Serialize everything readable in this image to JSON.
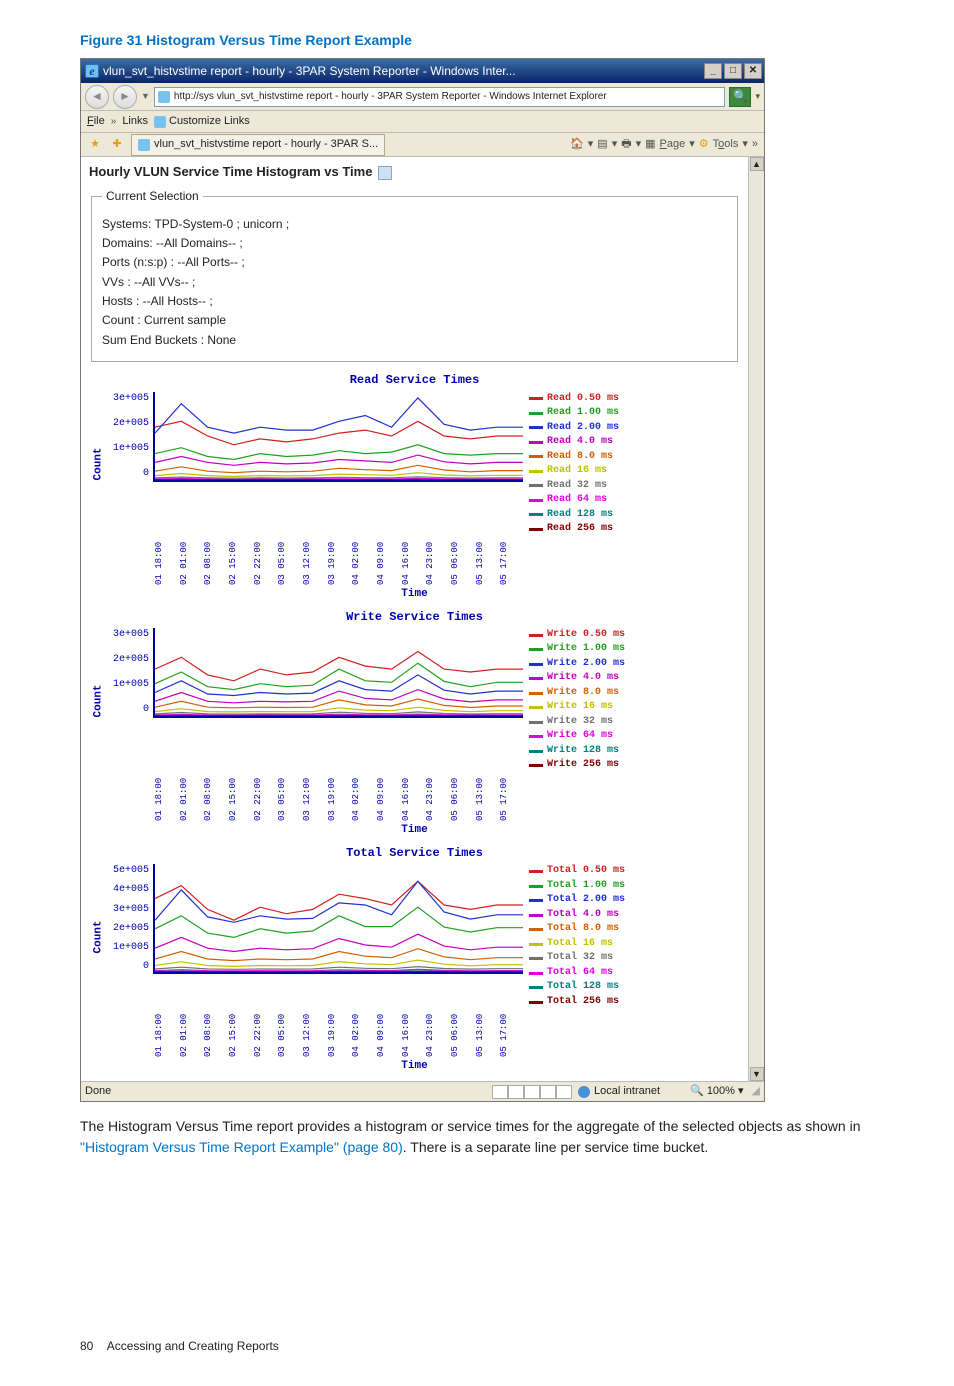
{
  "figure_caption": "Figure 31 Histogram Versus Time Report Example",
  "window": {
    "title": "vlun_svt_histvstime report - hourly - 3PAR System Reporter - Windows Inter...",
    "min": "_",
    "max": "□",
    "close": "✕"
  },
  "address": {
    "url": "http://sys vlun_svt_histvstime report - hourly - 3PAR System Reporter - Windows Internet Explorer",
    "go": "→"
  },
  "linksrow": {
    "file": "File",
    "chev": "»",
    "links": "Links",
    "customize": "Customize Links"
  },
  "tabsrow": {
    "tab_title": "vlun_svt_histvstime report - hourly - 3PAR S...",
    "page": "Page",
    "tools": "Tools",
    "chev": "»"
  },
  "report": {
    "title": "Hourly VLUN Service Time Histogram vs Time"
  },
  "selection": {
    "legend": "Current Selection",
    "systems": "Systems: TPD-System-0 ; unicorn ;",
    "domains": "Domains: --All Domains-- ;",
    "ports": "Ports (n:s:p) : --All Ports-- ;",
    "vvs": "VVs : --All VVs-- ;",
    "hosts": "Hosts : --All Hosts-- ;",
    "count": "Count : Current sample",
    "sum_end": "Sum End Buckets : None"
  },
  "charts": {
    "x_ticks": [
      "01 18:00",
      "02 01:00",
      "02 08:00",
      "02 15:00",
      "02 22:00",
      "03 05:00",
      "03 12:00",
      "03 19:00",
      "04 02:00",
      "04 09:00",
      "04 16:00",
      "04 23:00",
      "05 06:00",
      "05 13:00",
      "05 17:00"
    ],
    "x_title": "Time",
    "read": {
      "title": "Read Service Times",
      "ylabel": "Count",
      "yticks": [
        "3e+005",
        "2e+005",
        "1e+005",
        "0"
      ],
      "legend": [
        {
          "label": "Read 0.50 ms",
          "color": "#d02020"
        },
        {
          "label": "Read 1.00 ms",
          "color": "#20a020"
        },
        {
          "label": "Read 2.00 ms",
          "color": "#2030d0"
        },
        {
          "label": "Read 4.0 ms",
          "color": "#c000c0"
        },
        {
          "label": "Read 8.0 ms",
          "color": "#d06000"
        },
        {
          "label": "Read 16 ms",
          "color": "#c0c000"
        },
        {
          "label": "Read 32 ms",
          "color": "#707070"
        },
        {
          "label": "Read 64 ms",
          "color": "#e000e0"
        },
        {
          "label": "Read 128 ms",
          "color": "#008080"
        },
        {
          "label": "Read 256 ms",
          "color": "#800000"
        }
      ]
    },
    "write": {
      "title": "Write Service Times",
      "ylabel": "Count",
      "yticks": [
        "3e+005",
        "2e+005",
        "1e+005",
        "0"
      ],
      "legend": [
        {
          "label": "Write 0.50 ms",
          "color": "#d02020"
        },
        {
          "label": "Write 1.00 ms",
          "color": "#20a020"
        },
        {
          "label": "Write 2.00 ms",
          "color": "#2030d0"
        },
        {
          "label": "Write 4.0 ms",
          "color": "#c000c0"
        },
        {
          "label": "Write 8.0 ms",
          "color": "#d06000"
        },
        {
          "label": "Write 16 ms",
          "color": "#c0c000"
        },
        {
          "label": "Write 32 ms",
          "color": "#707070"
        },
        {
          "label": "Write 64 ms",
          "color": "#e000e0"
        },
        {
          "label": "Write 128 ms",
          "color": "#008080"
        },
        {
          "label": "Write 256 ms",
          "color": "#800000"
        }
      ]
    },
    "total": {
      "title": "Total Service Times",
      "ylabel": "Count",
      "yticks": [
        "5e+005",
        "4e+005",
        "3e+005",
        "2e+005",
        "1e+005",
        "0"
      ],
      "legend": [
        {
          "label": "Total 0.50 ms",
          "color": "#d02020"
        },
        {
          "label": "Total 1.00 ms",
          "color": "#20a020"
        },
        {
          "label": "Total 2.00 ms",
          "color": "#2030d0"
        },
        {
          "label": "Total 4.0 ms",
          "color": "#c000c0"
        },
        {
          "label": "Total 8.0 ms",
          "color": "#d06000"
        },
        {
          "label": "Total 16 ms",
          "color": "#c0c000"
        },
        {
          "label": "Total 32 ms",
          "color": "#707070"
        },
        {
          "label": "Total 64 ms",
          "color": "#e000e0"
        },
        {
          "label": "Total 128 ms",
          "color": "#008080"
        },
        {
          "label": "Total 256 ms",
          "color": "#800000"
        }
      ]
    }
  },
  "chart_data": [
    {
      "type": "line",
      "title": "Read Service Times",
      "xlabel": "Time",
      "ylabel": "Count",
      "ylim": [
        0,
        300000
      ],
      "categories": [
        "01 18:00",
        "02 01:00",
        "02 08:00",
        "02 15:00",
        "02 22:00",
        "03 05:00",
        "03 12:00",
        "03 19:00",
        "04 02:00",
        "04 09:00",
        "04 16:00",
        "04 23:00",
        "05 06:00",
        "05 13:00",
        "05 17:00"
      ],
      "series": [
        {
          "name": "Read 0.50 ms",
          "values": [
            180000,
            200000,
            150000,
            120000,
            140000,
            130000,
            140000,
            160000,
            170000,
            150000,
            200000,
            150000,
            140000,
            150000,
            150000
          ]
        },
        {
          "name": "Read 1.00 ms",
          "values": [
            90000,
            110000,
            80000,
            70000,
            90000,
            80000,
            85000,
            100000,
            90000,
            95000,
            120000,
            90000,
            85000,
            90000,
            90000
          ]
        },
        {
          "name": "Read 2.00 ms",
          "values": [
            160000,
            260000,
            180000,
            160000,
            180000,
            170000,
            170000,
            200000,
            220000,
            180000,
            280000,
            190000,
            170000,
            180000,
            180000
          ]
        },
        {
          "name": "Read 4.0 ms",
          "values": [
            60000,
            80000,
            60000,
            50000,
            60000,
            55000,
            58000,
            70000,
            65000,
            60000,
            85000,
            62000,
            55000,
            60000,
            60000
          ]
        },
        {
          "name": "Read 8.0 ms",
          "values": [
            30000,
            45000,
            30000,
            25000,
            30000,
            28000,
            30000,
            40000,
            35000,
            32000,
            50000,
            34000,
            28000,
            32000,
            32000
          ]
        },
        {
          "name": "Read 16 ms",
          "values": [
            15000,
            22000,
            15000,
            12000,
            15000,
            14000,
            15000,
            20000,
            18000,
            16000,
            25000,
            17000,
            14000,
            16000,
            16000
          ]
        },
        {
          "name": "Read 32 ms",
          "values": [
            7000,
            10000,
            7000,
            6000,
            7000,
            6500,
            7000,
            9000,
            8000,
            7500,
            11000,
            7800,
            6500,
            7500,
            7500
          ]
        },
        {
          "name": "Read 64 ms",
          "values": [
            3000,
            5000,
            3000,
            2500,
            3000,
            2800,
            3000,
            4000,
            3500,
            3200,
            5500,
            3400,
            2800,
            3200,
            3200
          ]
        },
        {
          "name": "Read 128 ms",
          "values": [
            1000,
            2000,
            1000,
            900,
            1000,
            950,
            1000,
            1500,
            1200,
            1100,
            2200,
            1150,
            950,
            1100,
            1100
          ]
        },
        {
          "name": "Read 256 ms",
          "values": [
            200,
            500,
            200,
            180,
            200,
            190,
            200,
            300,
            250,
            220,
            550,
            230,
            190,
            220,
            220
          ]
        }
      ]
    },
    {
      "type": "line",
      "title": "Write Service Times",
      "xlabel": "Time",
      "ylabel": "Count",
      "ylim": [
        0,
        300000
      ],
      "categories": [
        "01 18:00",
        "02 01:00",
        "02 08:00",
        "02 15:00",
        "02 22:00",
        "03 05:00",
        "03 12:00",
        "03 19:00",
        "04 02:00",
        "04 09:00",
        "04 16:00",
        "04 23:00",
        "05 06:00",
        "05 13:00",
        "05 17:00"
      ],
      "series": [
        {
          "name": "Write 0.50 ms",
          "values": [
            160000,
            200000,
            140000,
            120000,
            160000,
            140000,
            150000,
            200000,
            170000,
            160000,
            220000,
            160000,
            150000,
            160000,
            160000
          ]
        },
        {
          "name": "Write 1.00 ms",
          "values": [
            110000,
            150000,
            100000,
            90000,
            110000,
            100000,
            105000,
            160000,
            120000,
            115000,
            180000,
            118000,
            100000,
            115000,
            115000
          ]
        },
        {
          "name": "Write 2.00 ms",
          "values": [
            80000,
            120000,
            75000,
            70000,
            80000,
            75000,
            78000,
            120000,
            90000,
            85000,
            140000,
            88000,
            75000,
            85000,
            85000
          ]
        },
        {
          "name": "Write 4.0 ms",
          "values": [
            50000,
            80000,
            50000,
            45000,
            50000,
            48000,
            50000,
            85000,
            60000,
            55000,
            90000,
            58000,
            48000,
            55000,
            55000
          ]
        },
        {
          "name": "Write 8.0 ms",
          "values": [
            30000,
            50000,
            30000,
            28000,
            30000,
            29000,
            30000,
            55000,
            38000,
            34000,
            58000,
            36000,
            29000,
            34000,
            34000
          ]
        },
        {
          "name": "Write 16 ms",
          "values": [
            15000,
            25000,
            15000,
            14000,
            15000,
            14500,
            15000,
            28000,
            20000,
            18000,
            30000,
            19000,
            14500,
            18000,
            18000
          ]
        },
        {
          "name": "Write 32 ms",
          "values": [
            7000,
            12000,
            7000,
            6500,
            7000,
            6800,
            7000,
            13000,
            9000,
            8000,
            14000,
            8500,
            6800,
            8000,
            8000
          ]
        },
        {
          "name": "Write 64 ms",
          "values": [
            3000,
            5500,
            3000,
            2800,
            3000,
            2900,
            3000,
            6000,
            4000,
            3500,
            6500,
            3800,
            2900,
            3500,
            3500
          ]
        },
        {
          "name": "Write 128 ms",
          "values": [
            1000,
            2200,
            1000,
            950,
            1000,
            970,
            1000,
            2400,
            1500,
            1300,
            2600,
            1400,
            970,
            1300,
            1300
          ]
        },
        {
          "name": "Write 256 ms",
          "values": [
            200,
            550,
            200,
            190,
            200,
            195,
            200,
            600,
            300,
            260,
            650,
            280,
            195,
            260,
            260
          ]
        }
      ]
    },
    {
      "type": "line",
      "title": "Total Service Times",
      "xlabel": "Time",
      "ylabel": "Count",
      "ylim": [
        0,
        500000
      ],
      "categories": [
        "01 18:00",
        "02 01:00",
        "02 08:00",
        "02 15:00",
        "02 22:00",
        "03 05:00",
        "03 12:00",
        "03 19:00",
        "04 02:00",
        "04 09:00",
        "04 16:00",
        "04 23:00",
        "05 06:00",
        "05 13:00",
        "05 17:00"
      ],
      "series": [
        {
          "name": "Total 0.50 ms",
          "values": [
            340000,
            400000,
            290000,
            240000,
            300000,
            270000,
            290000,
            360000,
            340000,
            310000,
            420000,
            310000,
            290000,
            310000,
            310000
          ]
        },
        {
          "name": "Total 1.00 ms",
          "values": [
            200000,
            260000,
            180000,
            160000,
            200000,
            180000,
            190000,
            260000,
            210000,
            210000,
            300000,
            208000,
            185000,
            205000,
            205000
          ]
        },
        {
          "name": "Total 2.00 ms",
          "values": [
            240000,
            380000,
            255000,
            230000,
            260000,
            245000,
            248000,
            320000,
            310000,
            265000,
            420000,
            278000,
            245000,
            265000,
            265000
          ]
        },
        {
          "name": "Total 4.0 ms",
          "values": [
            110000,
            160000,
            110000,
            95000,
            110000,
            103000,
            108000,
            155000,
            125000,
            115000,
            175000,
            120000,
            103000,
            115000,
            115000
          ]
        },
        {
          "name": "Total 8.0 ms",
          "values": [
            60000,
            95000,
            60000,
            53000,
            60000,
            57000,
            60000,
            95000,
            73000,
            66000,
            108000,
            70000,
            57000,
            66000,
            66000
          ]
        },
        {
          "name": "Total 16 ms",
          "values": [
            30000,
            47000,
            30000,
            26000,
            30000,
            28500,
            30000,
            48000,
            38000,
            34000,
            55000,
            36000,
            28500,
            34000,
            34000
          ]
        },
        {
          "name": "Total 32 ms",
          "values": [
            14000,
            22000,
            14000,
            12500,
            14000,
            13300,
            14000,
            22000,
            17000,
            15500,
            25000,
            16300,
            13300,
            15500,
            15500
          ]
        },
        {
          "name": "Total 64 ms",
          "values": [
            6000,
            10500,
            6000,
            5300,
            6000,
            5700,
            6000,
            10000,
            7500,
            6700,
            12000,
            7200,
            5700,
            6700,
            6700
          ]
        },
        {
          "name": "Total 128 ms",
          "values": [
            2000,
            4200,
            2000,
            1850,
            2000,
            1920,
            2000,
            3900,
            2700,
            2400,
            4800,
            2550,
            1920,
            2400,
            2400
          ]
        },
        {
          "name": "Total 256 ms",
          "values": [
            400,
            1050,
            400,
            370,
            400,
            385,
            400,
            900,
            550,
            480,
            1200,
            510,
            385,
            480,
            480
          ]
        }
      ]
    }
  ],
  "statusbar": {
    "done": "Done",
    "intranet": "Local intranet",
    "zoom": "100%"
  },
  "body_text": {
    "p1a": "The Histogram Versus Time report provides a histogram or service times for the aggregate of the selected objects as shown in ",
    "link": "\"Histogram Versus Time Report Example\" (page 80)",
    "p1b": ". There is a separate line per service time bucket."
  },
  "footer": {
    "page": "80",
    "section": "Accessing and Creating Reports"
  }
}
